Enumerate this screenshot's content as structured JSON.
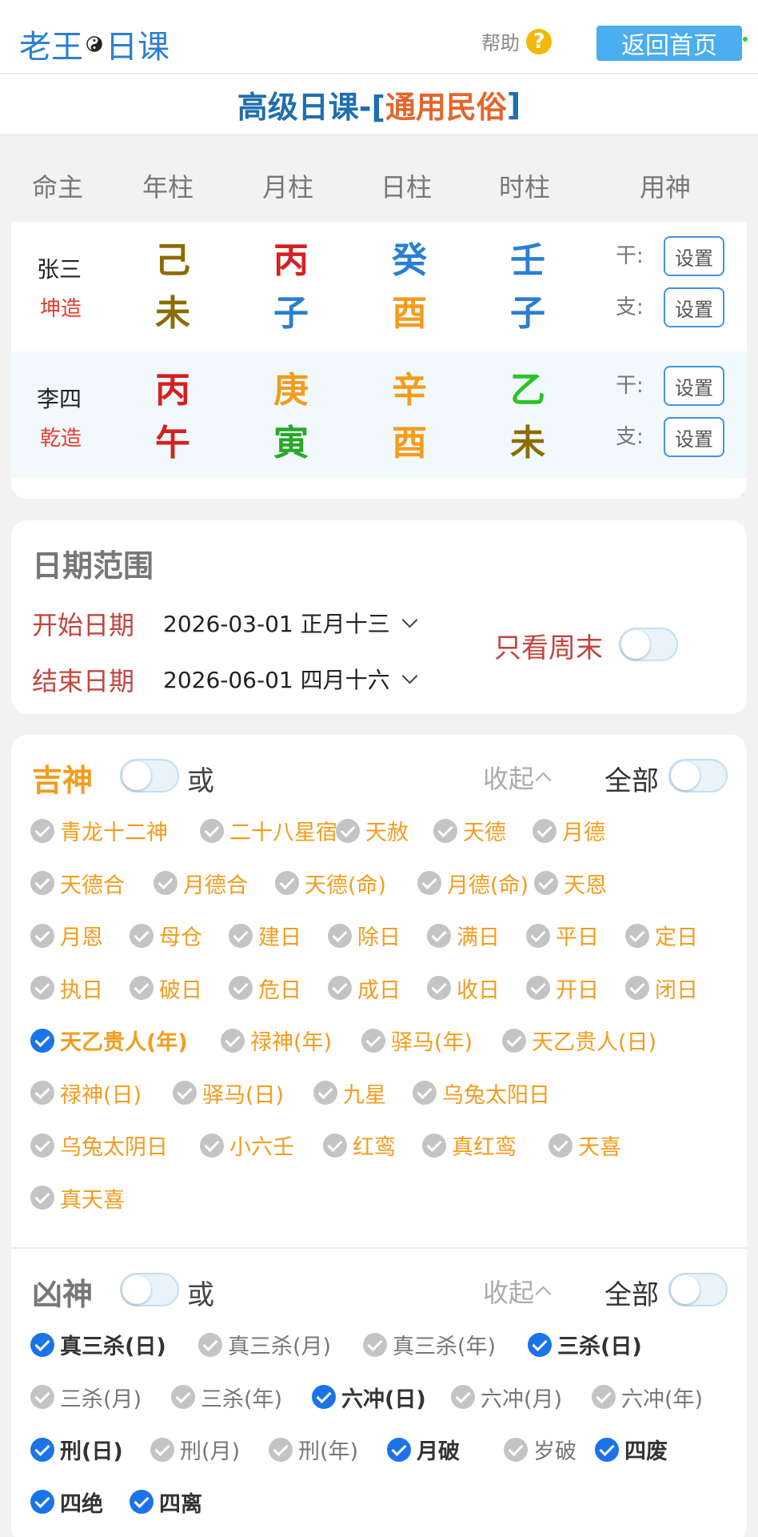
{
  "header": {
    "logo_left": "老王",
    "logo_right": "日课",
    "help_label": "帮助",
    "help_icon_text": "?",
    "home_button": "返回首页"
  },
  "title": {
    "part1": "高级日课-[",
    "part2": "通用民俗",
    "part3": "]"
  },
  "bazi": {
    "columns": [
      "命主",
      "年柱",
      "月柱",
      "日柱",
      "时柱",
      "用神"
    ],
    "gan_label": "干:",
    "zhi_label": "支:",
    "set_label": "设置",
    "people": [
      {
        "name": "张三",
        "gender": "坤造",
        "gan": [
          {
            "c": "己",
            "color": "#8a6d00"
          },
          {
            "c": "丙",
            "color": "#d62020"
          },
          {
            "c": "癸",
            "color": "#2a7fd0"
          },
          {
            "c": "壬",
            "color": "#2a7fd0"
          }
        ],
        "zhi": [
          {
            "c": "未",
            "color": "#8a6d00"
          },
          {
            "c": "子",
            "color": "#2a7fd0"
          },
          {
            "c": "酉",
            "color": "#f39c1e"
          },
          {
            "c": "子",
            "color": "#2a7fd0"
          }
        ]
      },
      {
        "name": "李四",
        "gender": "乾造",
        "gan": [
          {
            "c": "丙",
            "color": "#d62020"
          },
          {
            "c": "庚",
            "color": "#f39c1e"
          },
          {
            "c": "辛",
            "color": "#f39c1e"
          },
          {
            "c": "乙",
            "color": "#27c427"
          }
        ],
        "zhi": [
          {
            "c": "午",
            "color": "#d62020"
          },
          {
            "c": "寅",
            "color": "#27a827"
          },
          {
            "c": "酉",
            "color": "#f39c1e"
          },
          {
            "c": "未",
            "color": "#8a6d00"
          }
        ]
      }
    ]
  },
  "date_range": {
    "title": "日期范围",
    "start_label": "开始日期",
    "start_value": "2026-03-01 正月十三",
    "end_label": "结束日期",
    "end_value": "2026-06-01 四月十六",
    "weekend_label": "只看周末",
    "weekend_on": false
  },
  "jishen": {
    "title": "吉神",
    "or_label": "或",
    "collapse_label": "收起",
    "all_label": "全部",
    "items": [
      {
        "label": "青龙十二神",
        "checked": false
      },
      {
        "label": "二十八星宿",
        "checked": false
      },
      {
        "label": "天赦",
        "checked": false
      },
      {
        "label": "天德",
        "checked": false
      },
      {
        "label": "月德",
        "checked": false
      },
      {
        "label": "天德合",
        "checked": false
      },
      {
        "label": "月德合",
        "checked": false
      },
      {
        "label": "天德(命)",
        "checked": false
      },
      {
        "label": "月德(命)",
        "checked": false
      },
      {
        "label": "天恩",
        "checked": false
      },
      {
        "label": "月恩",
        "checked": false
      },
      {
        "label": "母仓",
        "checked": false
      },
      {
        "label": "建日",
        "checked": false
      },
      {
        "label": "除日",
        "checked": false
      },
      {
        "label": "满日",
        "checked": false
      },
      {
        "label": "平日",
        "checked": false
      },
      {
        "label": "定日",
        "checked": false
      },
      {
        "label": "执日",
        "checked": false
      },
      {
        "label": "破日",
        "checked": false
      },
      {
        "label": "危日",
        "checked": false
      },
      {
        "label": "成日",
        "checked": false
      },
      {
        "label": "收日",
        "checked": false
      },
      {
        "label": "开日",
        "checked": false
      },
      {
        "label": "闭日",
        "checked": false
      },
      {
        "label": "天乙贵人(年)",
        "checked": true
      },
      {
        "label": "禄神(年)",
        "checked": false
      },
      {
        "label": "驿马(年)",
        "checked": false
      },
      {
        "label": "天乙贵人(日)",
        "checked": false
      },
      {
        "label": "禄神(日)",
        "checked": false
      },
      {
        "label": "驿马(日)",
        "checked": false
      },
      {
        "label": "九星",
        "checked": false
      },
      {
        "label": "乌兔太阳日",
        "checked": false
      },
      {
        "label": "乌兔太阴日",
        "checked": false
      },
      {
        "label": "小六壬",
        "checked": false
      },
      {
        "label": "红鸾",
        "checked": false
      },
      {
        "label": "真红鸾",
        "checked": false
      },
      {
        "label": "天喜",
        "checked": false
      },
      {
        "label": "真天喜",
        "checked": false
      }
    ]
  },
  "xiongshen": {
    "title": "凶神",
    "or_label": "或",
    "collapse_label": "收起",
    "all_label": "全部",
    "items": [
      {
        "label": "真三杀(日)",
        "checked": true
      },
      {
        "label": "真三杀(月)",
        "checked": false
      },
      {
        "label": "真三杀(年)",
        "checked": false
      },
      {
        "label": "三杀(日)",
        "checked": true
      },
      {
        "label": "三杀(月)",
        "checked": false
      },
      {
        "label": "三杀(年)",
        "checked": false
      },
      {
        "label": "六冲(日)",
        "checked": true
      },
      {
        "label": "六冲(月)",
        "checked": false
      },
      {
        "label": "六冲(年)",
        "checked": false
      },
      {
        "label": "刑(日)",
        "checked": true
      },
      {
        "label": "刑(月)",
        "checked": false
      },
      {
        "label": "刑(年)",
        "checked": false
      },
      {
        "label": "月破",
        "checked": true
      },
      {
        "label": "岁破",
        "checked": false
      },
      {
        "label": "四废",
        "checked": true
      },
      {
        "label": "四绝",
        "checked": true
      },
      {
        "label": "四离",
        "checked": true
      }
    ]
  }
}
